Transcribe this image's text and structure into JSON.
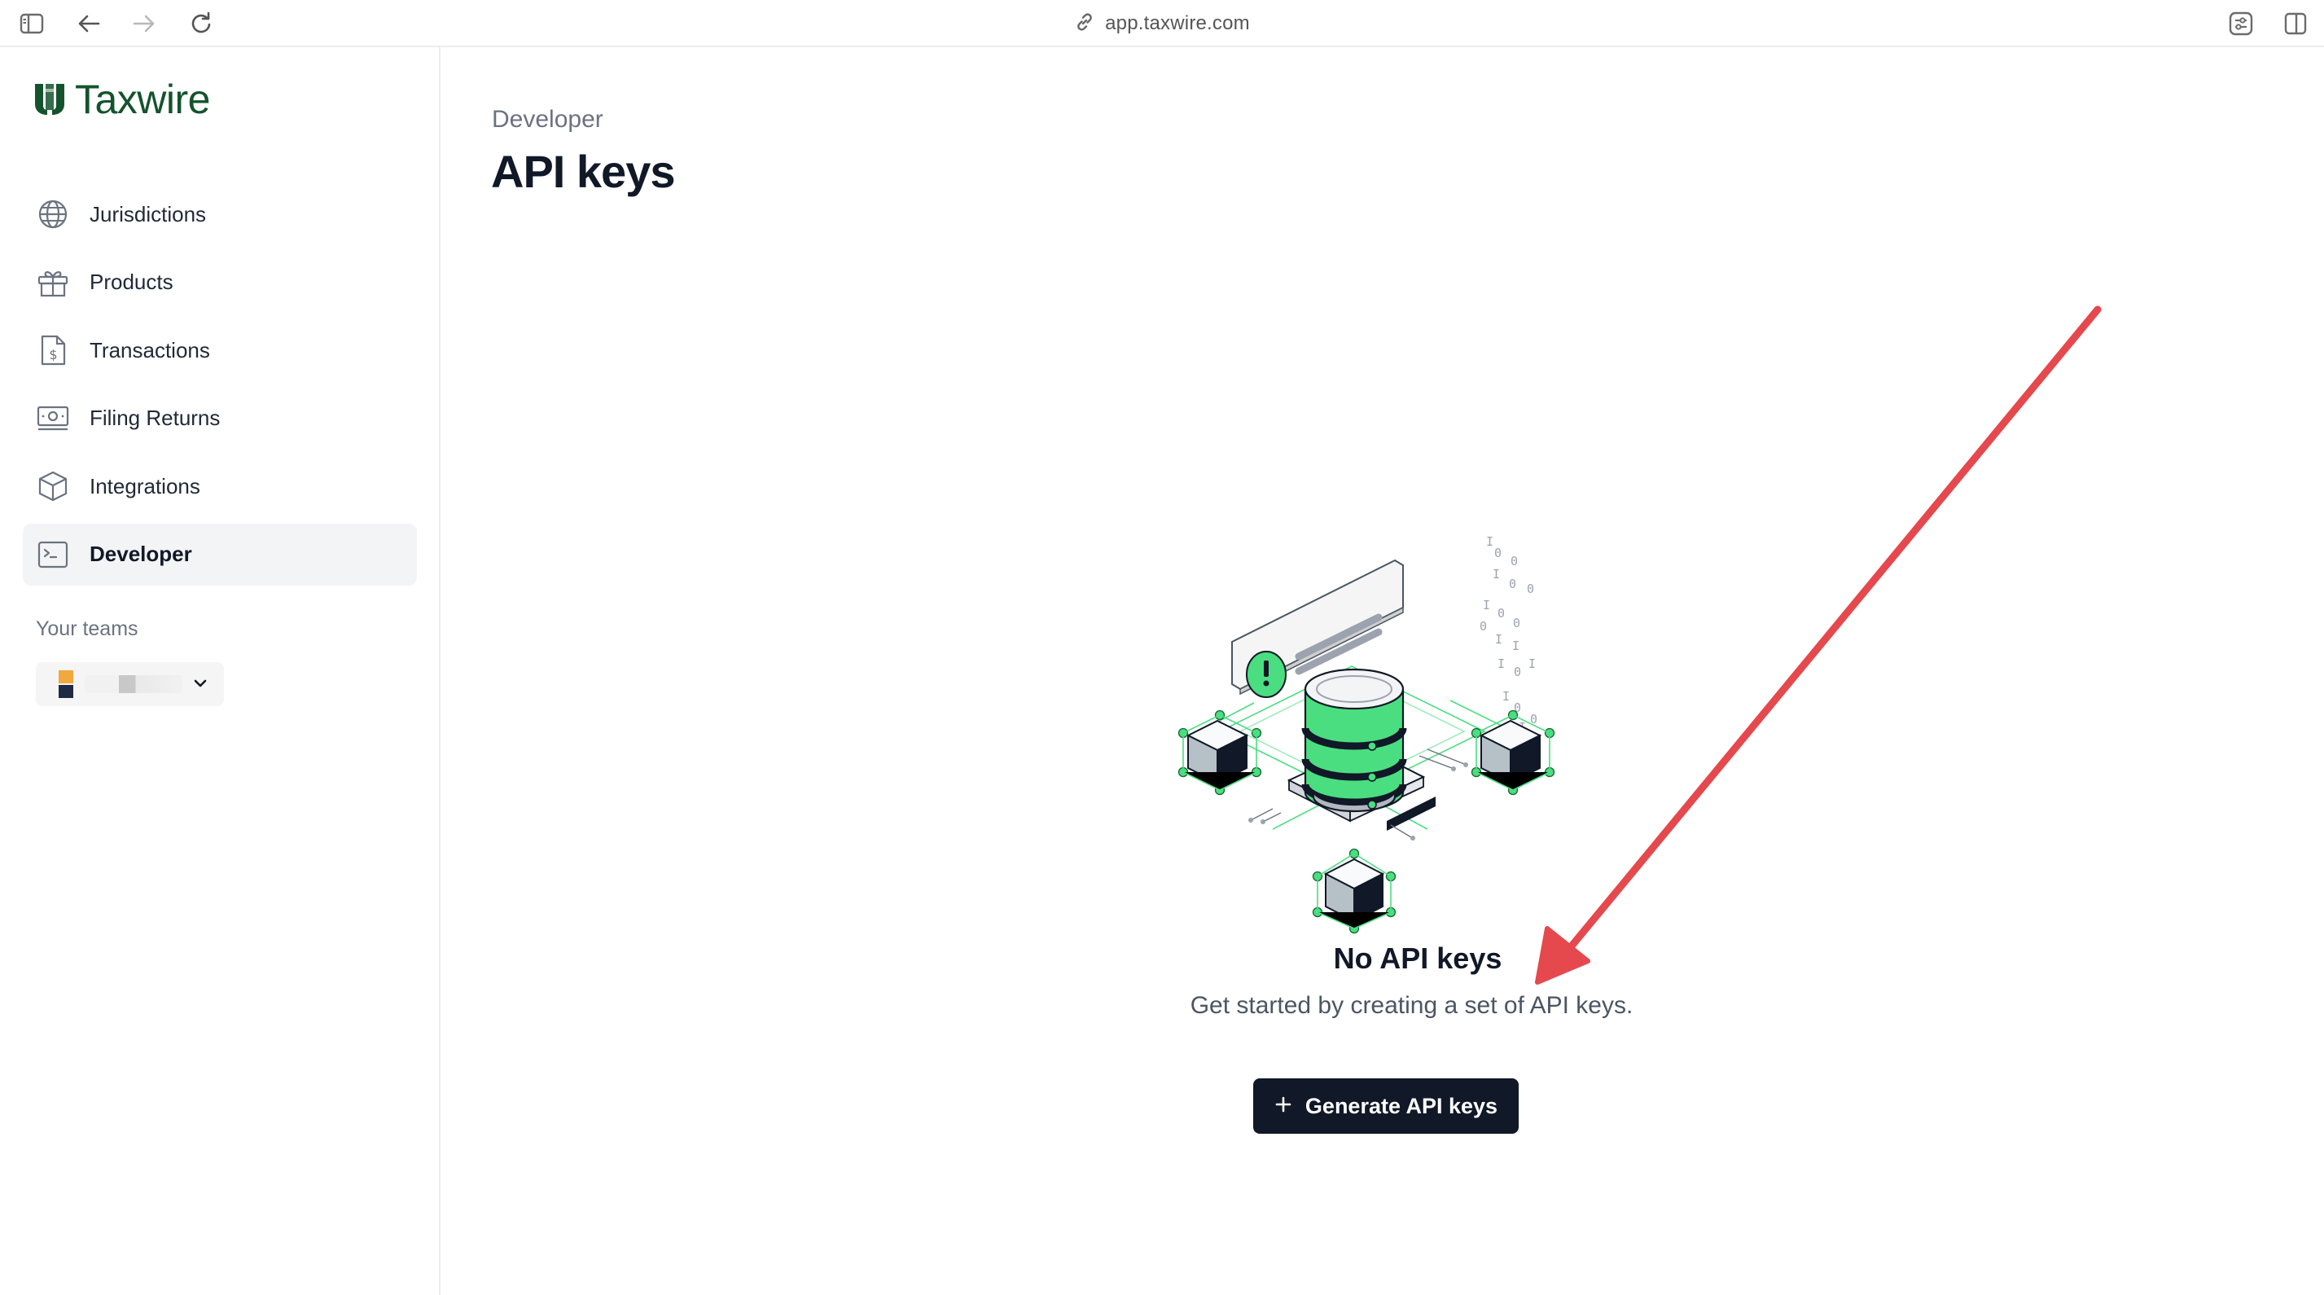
{
  "browser": {
    "url": "app.taxwire.com"
  },
  "sidebar": {
    "brand": "Taxwire",
    "items": [
      {
        "label": "Jurisdictions",
        "icon": "globe-icon"
      },
      {
        "label": "Products",
        "icon": "gift-icon"
      },
      {
        "label": "Transactions",
        "icon": "dollar-document-icon"
      },
      {
        "label": "Filing Returns",
        "icon": "money-icon"
      },
      {
        "label": "Integrations",
        "icon": "cube-icon"
      },
      {
        "label": "Developer",
        "icon": "terminal-icon",
        "active": true
      }
    ],
    "teams_label": "Your teams"
  },
  "main": {
    "breadcrumb": "Developer",
    "title": "API keys",
    "empty_state": {
      "title": "No API keys",
      "description": "Get started by creating a set of API keys.",
      "button_label": "Generate API keys"
    }
  },
  "colors": {
    "brand_green": "#14532d",
    "illustration_green": "#4ade80",
    "button_dark": "#111827",
    "annotation_red": "#e5484d"
  }
}
